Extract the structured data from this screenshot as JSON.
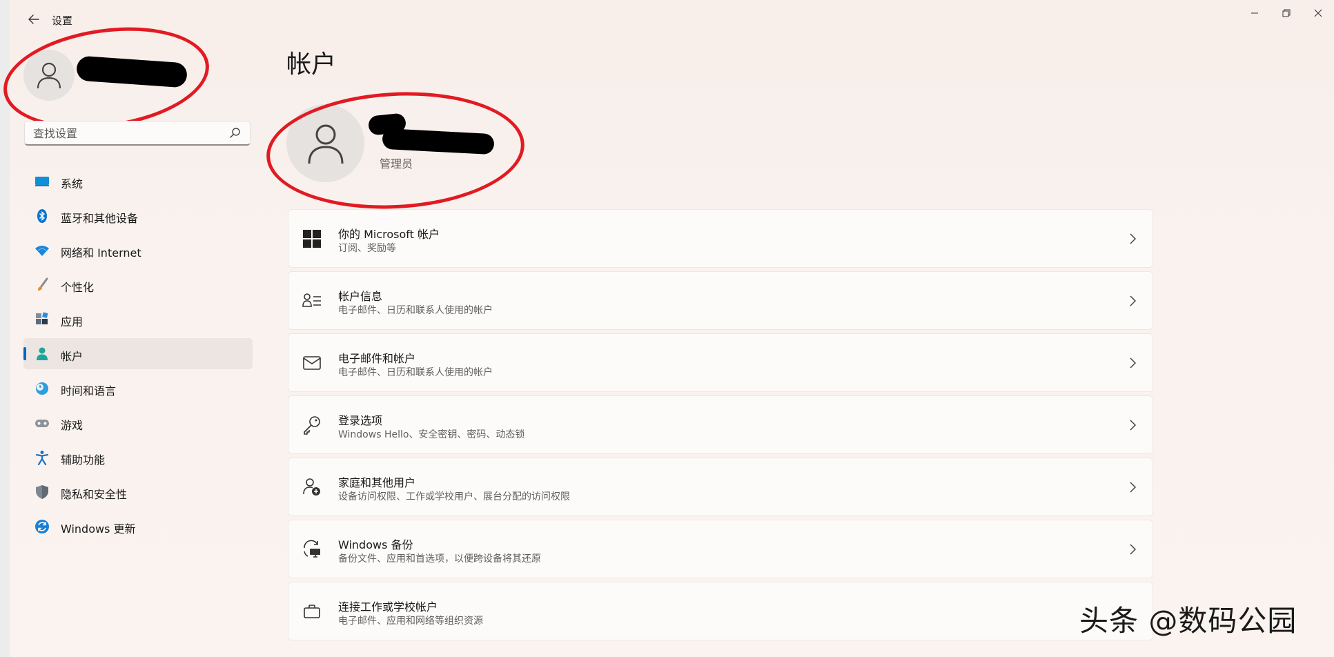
{
  "window": {
    "app_title": "设置",
    "controls": {
      "minimize": "minimize",
      "maximize": "maximize",
      "close": "close"
    }
  },
  "sidebar": {
    "search_placeholder": "查找设置",
    "items": [
      {
        "label": "系统",
        "icon": "monitor-icon",
        "active": false
      },
      {
        "label": "蓝牙和其他设备",
        "icon": "bluetooth-icon",
        "active": false
      },
      {
        "label": "网络和 Internet",
        "icon": "wifi-icon",
        "active": false
      },
      {
        "label": "个性化",
        "icon": "brush-icon",
        "active": false
      },
      {
        "label": "应用",
        "icon": "apps-icon",
        "active": false
      },
      {
        "label": "帐户",
        "icon": "person-icon",
        "active": true
      },
      {
        "label": "时间和语言",
        "icon": "clock-globe-icon",
        "active": false
      },
      {
        "label": "游戏",
        "icon": "gamepad-icon",
        "active": false
      },
      {
        "label": "辅助功能",
        "icon": "accessibility-icon",
        "active": false
      },
      {
        "label": "隐私和安全性",
        "icon": "shield-icon",
        "active": false
      },
      {
        "label": "Windows 更新",
        "icon": "update-icon",
        "active": false
      }
    ]
  },
  "main": {
    "title": "帐户",
    "user_role": "管理员",
    "cards": [
      {
        "title": "你的 Microsoft 帐户",
        "subtitle": "订阅、奖励等",
        "icon": "windows-logo-icon"
      },
      {
        "title": "帐户信息",
        "subtitle": "电子邮件、日历和联系人使用的帐户",
        "icon": "person-list-icon"
      },
      {
        "title": "电子邮件和帐户",
        "subtitle": "电子邮件、日历和联系人使用的帐户",
        "icon": "mail-icon"
      },
      {
        "title": "登录选项",
        "subtitle": "Windows Hello、安全密钥、密码、动态锁",
        "icon": "key-icon"
      },
      {
        "title": "家庭和其他用户",
        "subtitle": "设备访问权限、工作或学校用户、展台分配的访问权限",
        "icon": "person-add-icon"
      },
      {
        "title": "Windows 备份",
        "subtitle": "备份文件、应用和首选项，以便跨设备将其还原",
        "icon": "backup-icon"
      },
      {
        "title": "连接工作或学校帐户",
        "subtitle": "电子邮件、应用和网络等组织资源",
        "icon": "briefcase-icon"
      }
    ]
  },
  "watermark": "头条 @数码公园",
  "colors": {
    "accent": "#0067c0",
    "annotation_red": "#e21a22"
  }
}
